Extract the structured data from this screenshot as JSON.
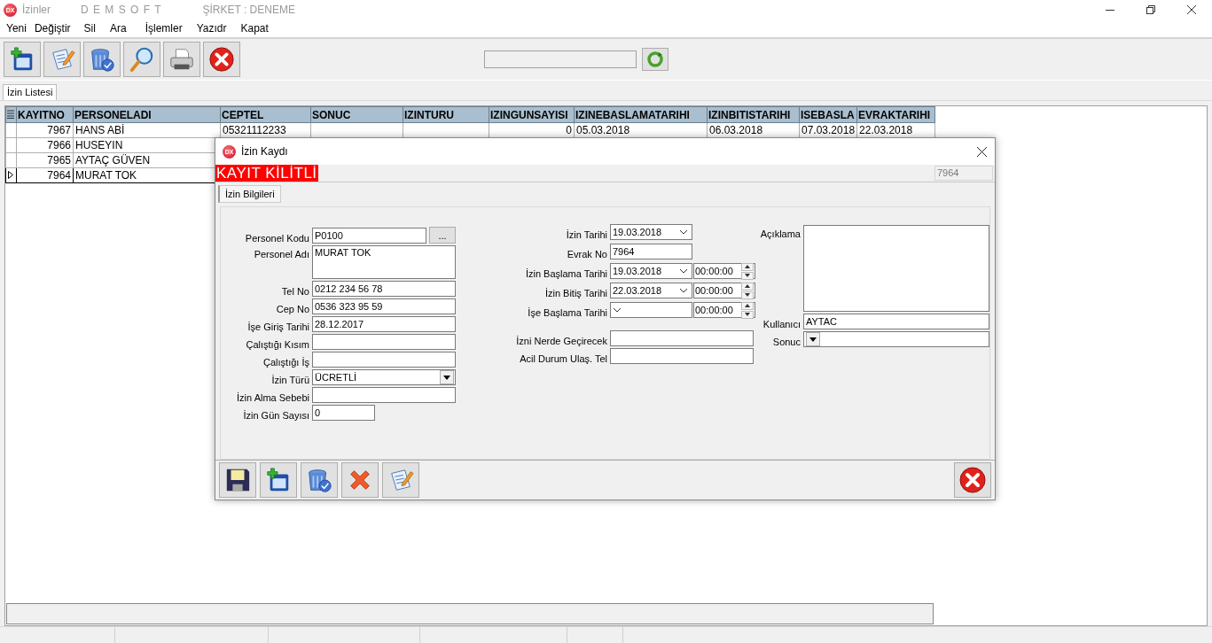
{
  "window": {
    "icon_text": "DX",
    "title": "İzinler",
    "brand": "D E M S O F T",
    "company": "ŞİRKET : DENEME"
  },
  "menu": [
    "Yeni",
    "Değiştir",
    "Sil",
    "Ara",
    "İşlemler",
    "Yazıdr",
    "Kapat"
  ],
  "tabs": [
    {
      "label": "İzin Listesi",
      "selected": true
    }
  ],
  "table": {
    "columns": [
      "KAYITNO",
      "PERSONELADI",
      "CEPTEL",
      "SONUC",
      "IZINTURU",
      "IZINGUNSAYISI",
      "IZINEBASLAMATARIHI",
      "IZINBITISTARIHI",
      "ISEBASLA",
      "EVRAKTARIHI"
    ],
    "rows": [
      {
        "selected": false,
        "cells": [
          "7967",
          "HANS ABİ",
          "05321112233",
          null,
          null,
          "0",
          "05.03.2018",
          "06.03.2018",
          "07.03.2018",
          "22.03.2018"
        ]
      },
      {
        "selected": false,
        "cells": [
          "7966",
          "HUSEYIN"
        ]
      },
      {
        "selected": false,
        "cells": [
          "7965",
          "AYTAÇ GÜVEN"
        ]
      },
      {
        "selected": true,
        "cells": [
          "7964",
          "MURAT TOK"
        ]
      }
    ]
  },
  "dialog": {
    "icon_text": "DX",
    "title": "İzin Kaydı",
    "banner": "KAYIT KİLİTLİ",
    "record_no": "7964",
    "tabs": [
      {
        "label": "İzin Bilgileri",
        "selected": true
      }
    ],
    "left": [
      {
        "kind": "lookup",
        "label": "Personel Kodu",
        "value": "P0100",
        "button": "..."
      },
      {
        "kind": "memo",
        "label": "Personel Adı",
        "value": "MURAT TOK"
      },
      {
        "kind": "text",
        "label": "Tel No",
        "value": "0212 234 56 78"
      },
      {
        "kind": "text",
        "label": "Cep No",
        "value": "0536 323 95 59"
      },
      {
        "kind": "text",
        "label": "İşe Giriş Tarihi",
        "value": "28.12.2017"
      },
      {
        "kind": "text",
        "label": "Çalıştığı Kısım"
      },
      {
        "kind": "text",
        "label": "Çalıştığı İş"
      },
      {
        "kind": "combo",
        "label": "İzin Türü",
        "value": "ÜCRETLİ"
      },
      {
        "kind": "text",
        "label": "İzin Alma Sebebi"
      },
      {
        "kind": "number",
        "label": "İzin Gün Sayısı",
        "value": "0"
      }
    ],
    "center_dates": [
      {
        "kind": "date",
        "label": "İzin Tarihi",
        "value": "19.03.2018"
      },
      {
        "kind": "text",
        "label": "Evrak No",
        "value": "7964"
      },
      {
        "kind": "datetime",
        "label": "İzin Başlama Tarihi",
        "value": "19.03.2018",
        "time": "00:00:00"
      },
      {
        "kind": "datetime",
        "label": "İzin Bitiş Tarihi",
        "value": "22.03.2018",
        "time": "00:00:00"
      },
      {
        "kind": "datetime",
        "label": "İşe Başlama Tarihi",
        "time": "00:00:00"
      }
    ],
    "center_extra": [
      {
        "kind": "wide",
        "label": "İzni Nerde Geçirecek"
      },
      {
        "kind": "wide",
        "label": "Acil Durum Ulaş. Tel"
      }
    ],
    "right": [
      {
        "kind": "memo",
        "label": "Açıklama"
      },
      {
        "kind": "text",
        "label": "Kullanıcı",
        "value": "AYTAC"
      },
      {
        "kind": "combo",
        "label": "Sonuc"
      }
    ]
  }
}
